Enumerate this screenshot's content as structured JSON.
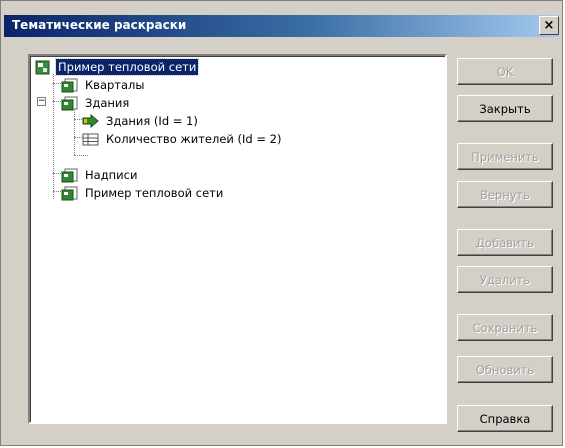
{
  "window": {
    "title": "Тематические раскраски",
    "close_glyph": "×"
  },
  "tree": {
    "nodes": [
      {
        "label": "Пример тепловой сети",
        "icon": "map-root-icon",
        "selected": true
      },
      {
        "label": "Кварталы",
        "icon": "layer-icon"
      },
      {
        "label": "Здания",
        "icon": "layer-icon",
        "expander": "−"
      },
      {
        "label": "Здания (Id = 1)",
        "icon": "arrow-theme-icon"
      },
      {
        "label": "Количество жителей (Id = 2)",
        "icon": "table-theme-icon"
      },
      {
        "label": "Надписи",
        "icon": "layer-icon"
      },
      {
        "label": "Пример тепловой сети",
        "icon": "layer-icon"
      }
    ]
  },
  "buttons": [
    {
      "label": "OK",
      "enabled": false
    },
    {
      "label": "Закрыть",
      "enabled": true
    },
    {
      "label": "Применить",
      "enabled": false
    },
    {
      "label": "Вернуть",
      "enabled": false
    },
    {
      "label": "Добавить",
      "enabled": false
    },
    {
      "label": "Удалить",
      "enabled": false
    },
    {
      "label": "Сохранить",
      "enabled": false
    },
    {
      "label": "Обновить",
      "enabled": false
    },
    {
      "label": "Справка",
      "enabled": true
    }
  ],
  "colors": {
    "titlebar_start": "#0a246a",
    "titlebar_end": "#a6caf0",
    "dialog_face": "#d4d0c8",
    "selection": "#0a246a"
  }
}
